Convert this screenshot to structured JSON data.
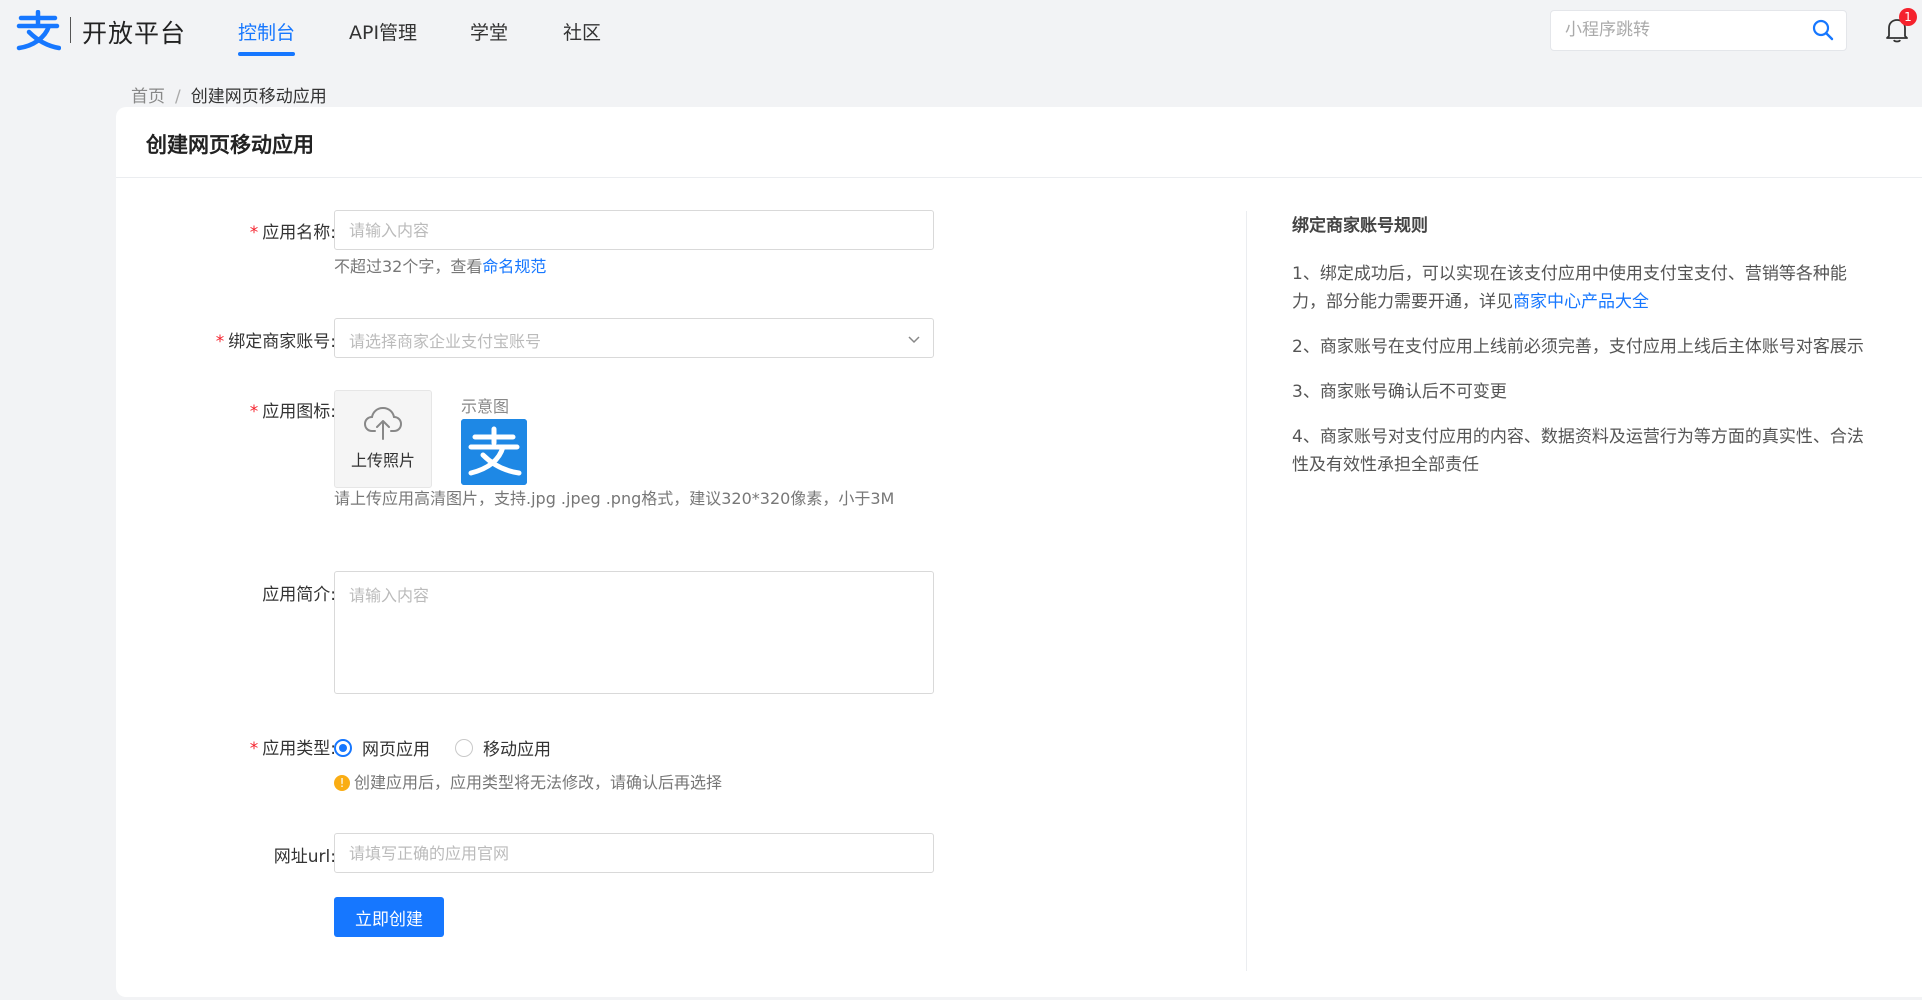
{
  "header": {
    "brand": "开放平台",
    "nav": [
      "控制台",
      "API管理",
      "学堂",
      "社区"
    ],
    "active_nav": "控制台",
    "search_placeholder": "小程序跳转",
    "notification_count": "1"
  },
  "breadcrumb": {
    "home": "首页",
    "separator": "/",
    "current": "创建网页移动应用"
  },
  "page": {
    "title": "创建网页移动应用"
  },
  "form": {
    "name": {
      "label": "应用名称:",
      "placeholder": "请输入内容",
      "hint_prefix": "不超过32个字，查看",
      "hint_link": "命名规范",
      "required": true
    },
    "merchant": {
      "label": "绑定商家账号:",
      "placeholder": "请选择商家企业支付宝账号",
      "required": true
    },
    "icon": {
      "label": "应用图标:",
      "upload_label": "上传照片",
      "sample_label": "示意图",
      "hint": "请上传应用高清图片，支持.jpg .jpeg .png格式，建议320*320像素，小于3M",
      "required": true
    },
    "intro": {
      "label": "应用简介:",
      "placeholder": "请输入内容",
      "required": false
    },
    "type": {
      "label": "应用类型:",
      "options": [
        "网页应用",
        "移动应用"
      ],
      "selected": "网页应用",
      "warning": "创建应用后，应用类型将无法修改，请确认后再选择",
      "required": true
    },
    "url": {
      "label": "网址url:",
      "placeholder": "请填写正确的应用官网",
      "required": false
    },
    "submit_label": "立即创建"
  },
  "rules": {
    "title": "绑定商家账号规则",
    "items": [
      {
        "text": "1、绑定成功后，可以实现在该支付应用中使用支付宝支付、营销等各种能力，部分能力需要开通，详见",
        "link": "商家中心产品大全"
      },
      {
        "text": "2、商家账号在支付应用上线前必须完善，支付应用上线后主体账号对客展示",
        "link": ""
      },
      {
        "text": "3、商家账号确认后不可变更",
        "link": ""
      },
      {
        "text": "4、商家账号对支付应用的内容、数据资料及运营行为等方面的真实性、合法性及有效性承担全部责任",
        "link": ""
      }
    ]
  },
  "colors": {
    "primary": "#1677ff",
    "required": "#f5222d",
    "warning": "#faad14",
    "alipay_blue": "#1e88e5"
  },
  "icons": [
    "alipay-logo-icon",
    "search-icon",
    "bell-icon",
    "chevron-down-icon",
    "cloud-upload-icon",
    "warning-icon"
  ]
}
